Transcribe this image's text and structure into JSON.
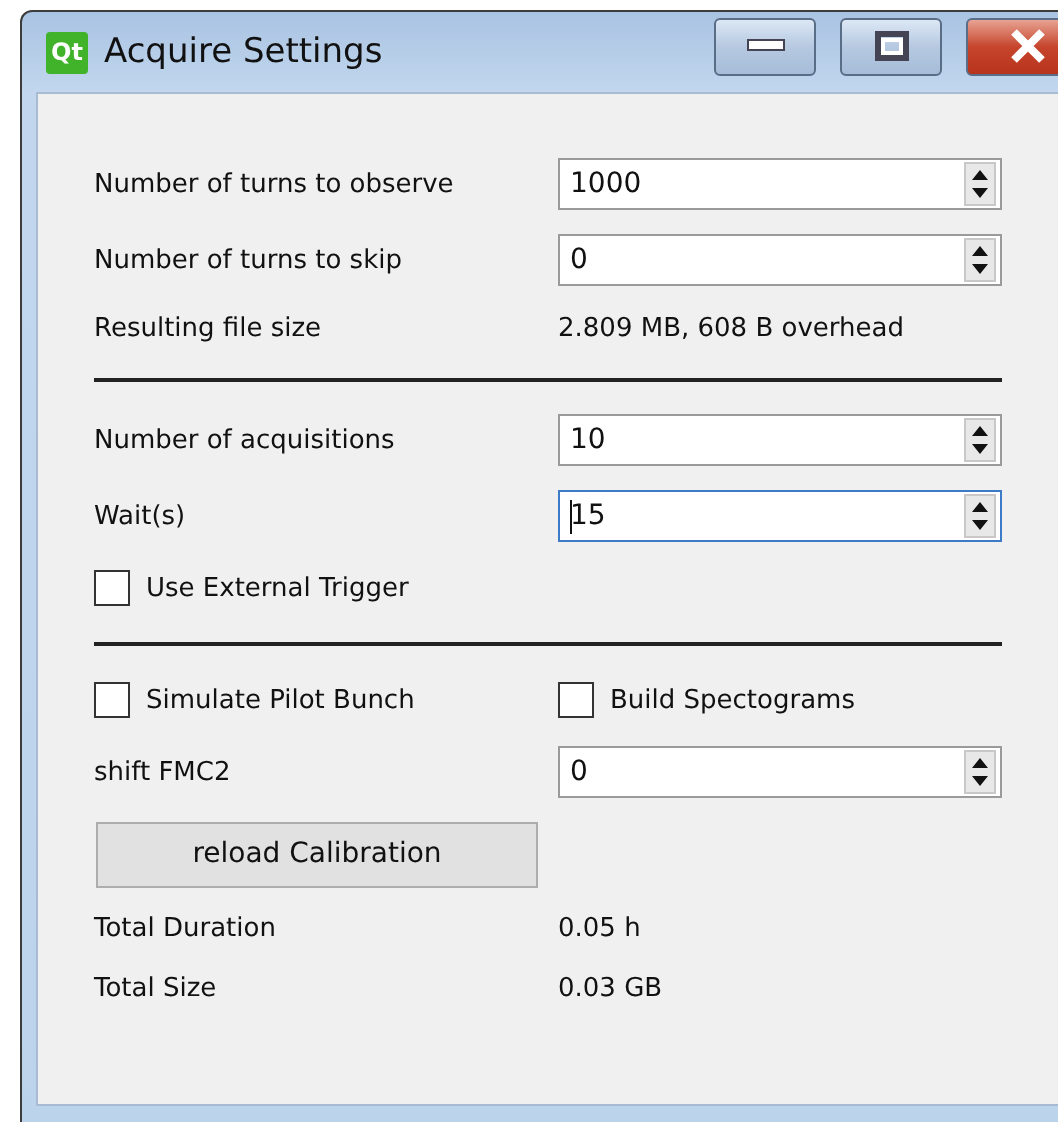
{
  "window": {
    "logo": "Qt",
    "title": "Acquire Settings"
  },
  "rows": [
    {
      "kind": "spin",
      "label": "Number of turns to observe",
      "value": "1000",
      "focused": false
    },
    {
      "kind": "spin",
      "label": "Number of turns to skip",
      "value": "0",
      "focused": false
    },
    {
      "kind": "info",
      "label": "Resulting file size",
      "value": "2.809 MB, 608 B overhead"
    },
    {
      "kind": "divider"
    },
    {
      "kind": "spin",
      "label": "Number of acquisitions",
      "value": "10",
      "focused": false
    },
    {
      "kind": "spin",
      "label": "Wait(s)",
      "value": "15",
      "focused": true
    },
    {
      "kind": "checks",
      "items": [
        {
          "label": "Use External Trigger",
          "checked": false
        }
      ]
    },
    {
      "kind": "divider"
    },
    {
      "kind": "checks",
      "items": [
        {
          "label": "Simulate Pilot Bunch",
          "checked": false
        },
        {
          "label": "Build Spectograms",
          "checked": false
        }
      ]
    },
    {
      "kind": "spin",
      "label": "shift FMC2",
      "value": "0",
      "focused": false
    },
    {
      "kind": "button",
      "label": "reload Calibration"
    },
    {
      "kind": "info",
      "label": "Total Duration",
      "value": "0.05 h"
    },
    {
      "kind": "info",
      "label": "Total Size",
      "value": "0.03 GB"
    }
  ]
}
